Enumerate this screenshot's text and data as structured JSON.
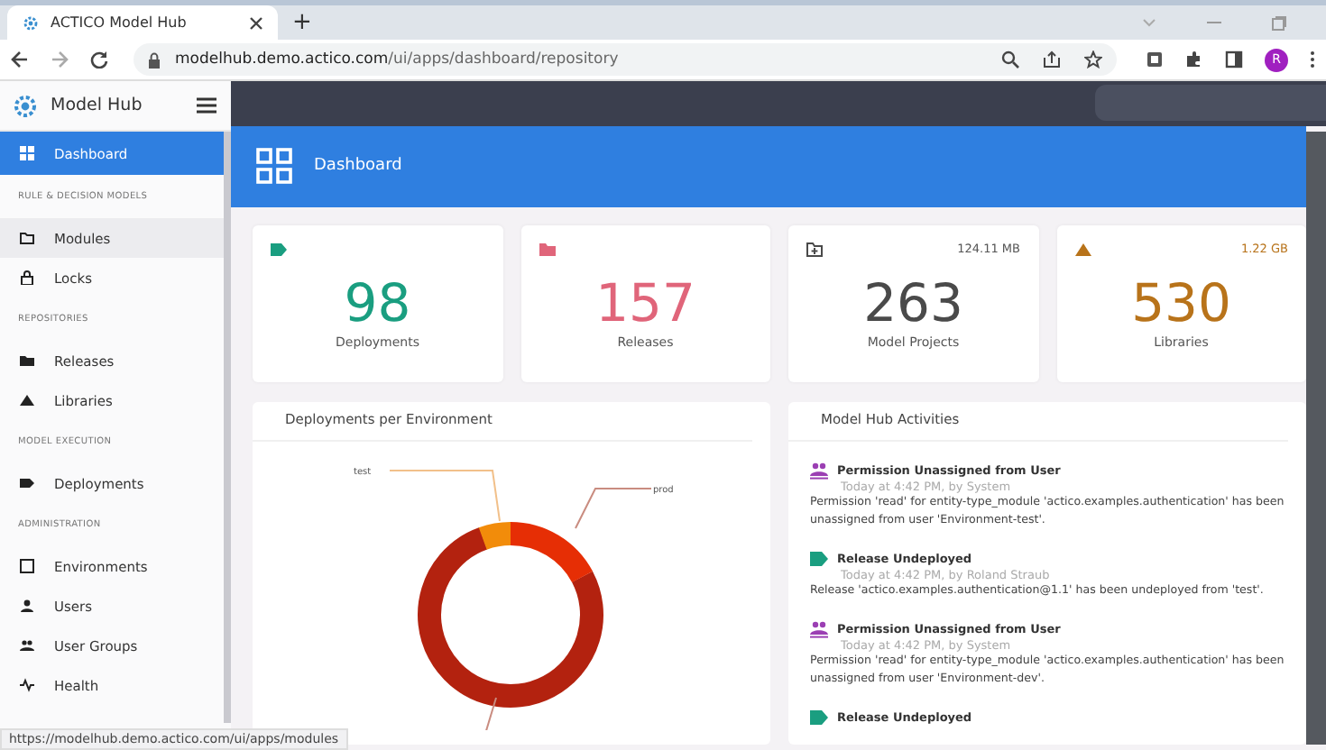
{
  "browser": {
    "tab_title": "ACTICO Model Hub",
    "new_tab": "+",
    "url_host": "modelhub.demo.actico.com",
    "url_path": "/ui/apps/dashboard/repository",
    "profile_initial": "R",
    "status_url": "https://modelhub.demo.actico.com/ui/apps/modules"
  },
  "app": {
    "brand": "Model Hub"
  },
  "sidebar": {
    "items": [
      {
        "kind": "link",
        "label": "Dashboard",
        "selected": true,
        "hovered": false
      },
      {
        "kind": "section",
        "label": "RULE & DECISION MODELS"
      },
      {
        "kind": "link",
        "label": "Modules",
        "selected": false,
        "hovered": true
      },
      {
        "kind": "link",
        "label": "Locks",
        "selected": false,
        "hovered": false
      },
      {
        "kind": "section",
        "label": "REPOSITORIES"
      },
      {
        "kind": "link",
        "label": "Releases",
        "selected": false,
        "hovered": false
      },
      {
        "kind": "link",
        "label": "Libraries",
        "selected": false,
        "hovered": false
      },
      {
        "kind": "section",
        "label": "MODEL EXECUTION"
      },
      {
        "kind": "link",
        "label": "Deployments",
        "selected": false,
        "hovered": false
      },
      {
        "kind": "section",
        "label": "ADMINISTRATION"
      },
      {
        "kind": "link",
        "label": "Environments",
        "selected": false,
        "hovered": false
      },
      {
        "kind": "link",
        "label": "Users",
        "selected": false,
        "hovered": false
      },
      {
        "kind": "link",
        "label": "User Groups",
        "selected": false,
        "hovered": false
      },
      {
        "kind": "link",
        "label": "Health",
        "selected": false,
        "hovered": false
      }
    ]
  },
  "banner": {
    "title": "Dashboard"
  },
  "cards": [
    {
      "value": "98",
      "label": "Deployments",
      "color": "#1a9e80"
    },
    {
      "value": "157",
      "label": "Releases",
      "color": "#e0657a"
    },
    {
      "value": "263",
      "label": "Model Projects",
      "size": "124.11 MB",
      "color": "#4a4a4a"
    },
    {
      "value": "530",
      "label": "Libraries",
      "size": "1.22 GB",
      "color": "#b8731a"
    }
  ],
  "chart_panel": {
    "title": "Deployments per Environment",
    "labels": [
      "test",
      "prod"
    ]
  },
  "activities": {
    "title": "Model Hub Activities",
    "items": [
      {
        "kind": "permission",
        "title": "Permission Unassigned from User",
        "meta": "Today at 4:42 PM, by System",
        "text": "Permission 'read' for entity-type_module 'actico.examples.authentication' has been unassigned from user 'Environment-test'."
      },
      {
        "kind": "release",
        "title": "Release Undeployed",
        "meta": "Today at 4:42 PM, by Roland Straub",
        "text": "Release 'actico.examples.authentication@1.1' has been undeployed from 'test'."
      },
      {
        "kind": "permission",
        "title": "Permission Unassigned from User",
        "meta": "Today at 4:42 PM, by System",
        "text": "Permission 'read' for entity-type_module 'actico.examples.authentication' has been unassigned from user 'Environment-dev'."
      },
      {
        "kind": "release",
        "title": "Release Undeployed"
      }
    ]
  }
}
